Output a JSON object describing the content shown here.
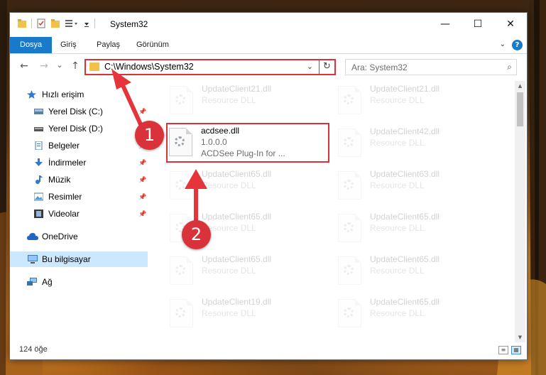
{
  "window": {
    "title": "System32",
    "controls": {
      "minimize": "—",
      "maximize": "☐",
      "close": "✕"
    }
  },
  "ribbon": {
    "tabs": [
      "Dosya",
      "Giriş",
      "Paylaş",
      "Görünüm"
    ],
    "help": "?"
  },
  "nav": {
    "back": "←",
    "forward": "→",
    "recent": "⌄",
    "up": "↑",
    "address": "C:\\Windows\\System32",
    "search_placeholder": "Ara: System32"
  },
  "sidebar": {
    "items": [
      {
        "label": "Hızlı erişim",
        "icon": "star-icon"
      },
      {
        "label": "Yerel Disk (C:)",
        "icon": "drive-icon",
        "pinned": true
      },
      {
        "label": "Yerel Disk (D:)",
        "icon": "drive-icon",
        "pinned": true
      },
      {
        "label": "Belgeler",
        "icon": "documents-icon",
        "pinned": true
      },
      {
        "label": "İndirmeler",
        "icon": "download-icon",
        "pinned": true
      },
      {
        "label": "Müzik",
        "icon": "music-icon",
        "pinned": true
      },
      {
        "label": "Resimler",
        "icon": "pictures-icon",
        "pinned": true
      },
      {
        "label": "Videolar",
        "icon": "videos-icon",
        "pinned": true
      },
      {
        "label": "OneDrive",
        "icon": "cloud-icon"
      },
      {
        "label": "Bu bilgisayar",
        "icon": "computer-icon",
        "selected": true
      },
      {
        "label": "Ağ",
        "icon": "network-icon"
      }
    ]
  },
  "files": {
    "highlighted": {
      "name": "acdsee.dll",
      "version": "1.0.0.0",
      "description": "ACDSee Plug-In for ..."
    },
    "faded_left": [
      {
        "name": "UpdateClient21.dll",
        "type": "Resource DLL"
      },
      {
        "name": "UpdateClient65.dll",
        "type": "Resource DLL"
      },
      {
        "name": "UpdateClient65.dll",
        "type": "Resource DLL"
      },
      {
        "name": "UpdateClient65.dll",
        "type": "Resource DLL"
      },
      {
        "name": "UpdateClient19.dll",
        "type": "Resource DLL"
      }
    ],
    "faded_right": [
      {
        "name": "UpdateClient21.dll",
        "type": "Resource DLL"
      },
      {
        "name": "UpdateClient42.dll",
        "type": "Resource DLL"
      },
      {
        "name": "UpdateClient63.dll",
        "type": "Resource DLL"
      },
      {
        "name": "UpdateClient65.dll",
        "type": "Resource DLL"
      },
      {
        "name": "UpdateClient65.dll",
        "type": "Resource DLL"
      },
      {
        "name": "UpdateClient65.dll",
        "type": "Resource DLL"
      }
    ]
  },
  "status": {
    "count": "124 öğe"
  },
  "annotations": {
    "step1": "1",
    "step2": "2"
  },
  "colors": {
    "accent": "#1979ca",
    "highlight": "#d9323a",
    "selected_bg": "#cce8ff"
  }
}
